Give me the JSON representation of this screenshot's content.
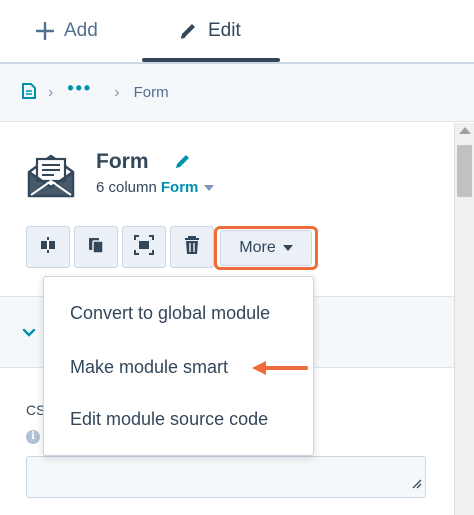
{
  "tabs": {
    "add_label": "Add",
    "edit_label": "Edit"
  },
  "breadcrumb": {
    "current": "Form"
  },
  "module": {
    "title": "Form",
    "subtitle_prefix": "6 column",
    "subtitle_link": "Form"
  },
  "toolbar": {
    "more_label": "More"
  },
  "menu": {
    "items": [
      "Convert to global module",
      "Make module smart",
      "Edit module source code"
    ]
  },
  "field": {
    "label": "CSS"
  },
  "colors": {
    "accent": "#0091ae",
    "highlight": "#ef6b3a",
    "text": "#33475b"
  }
}
